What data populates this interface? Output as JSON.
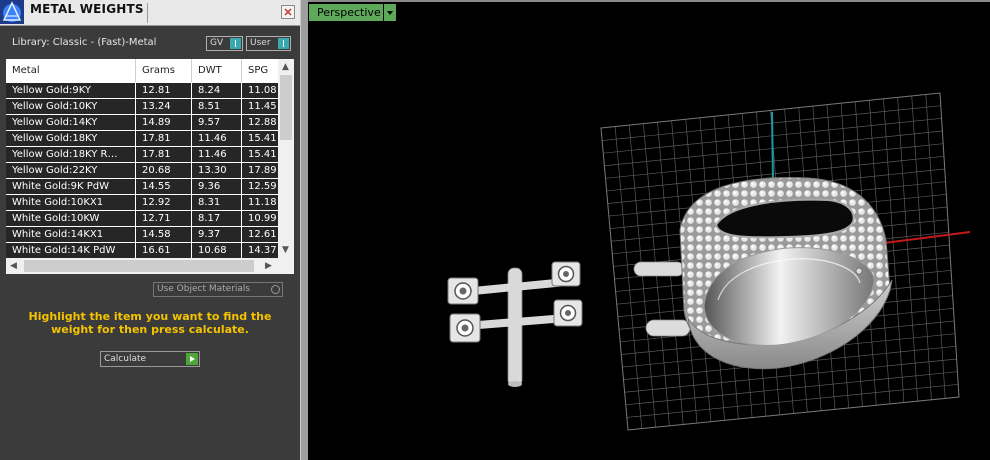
{
  "panel": {
    "title": "METAL WEIGHTS",
    "library_label": "Library: Classic - (Fast)-Metal",
    "toggle_gv": "GV",
    "toggle_user": "User",
    "columns": [
      "Metal",
      "Grams",
      "DWT",
      "SPG"
    ],
    "rows": [
      {
        "metal": "Yellow Gold:9KY",
        "grams": "12.81",
        "dwt": "8.24",
        "spg": "11.08"
      },
      {
        "metal": "Yellow Gold:10KY",
        "grams": "13.24",
        "dwt": "8.51",
        "spg": "11.45"
      },
      {
        "metal": "Yellow Gold:14KY",
        "grams": "14.89",
        "dwt": "9.57",
        "spg": "12.88"
      },
      {
        "metal": "Yellow Gold:18KY",
        "grams": "17.81",
        "dwt": "11.46",
        "spg": "15.41"
      },
      {
        "metal": "Yellow Gold:18KY R…",
        "grams": "17.81",
        "dwt": "11.46",
        "spg": "15.41"
      },
      {
        "metal": "Yellow Gold:22KY",
        "grams": "20.68",
        "dwt": "13.30",
        "spg": "17.89"
      },
      {
        "metal": "White Gold:9K PdW",
        "grams": "14.55",
        "dwt": "9.36",
        "spg": "12.59"
      },
      {
        "metal": "White Gold:10KX1",
        "grams": "12.92",
        "dwt": "8.31",
        "spg": "11.18"
      },
      {
        "metal": "White Gold:10KW",
        "grams": "12.71",
        "dwt": "8.17",
        "spg": "10.99"
      },
      {
        "metal": "White Gold:14KX1",
        "grams": "14.58",
        "dwt": "9.37",
        "spg": "12.61"
      },
      {
        "metal": "White Gold:14K PdW",
        "grams": "16.61",
        "dwt": "10.68",
        "spg": "14.37"
      }
    ],
    "use_object_materials": "Use Object Materials",
    "hint": "Highlight the item you want to find the weight for then press calculate.",
    "calculate_label": "Calculate"
  },
  "viewport": {
    "view_name": "Perspective"
  },
  "colors": {
    "panel_bg": "#3b3b3b",
    "hint_text": "#f5c400",
    "view_button": "#5ea85a",
    "toggle_on": "#3aa8b0",
    "calc_go": "#4ea63a"
  }
}
